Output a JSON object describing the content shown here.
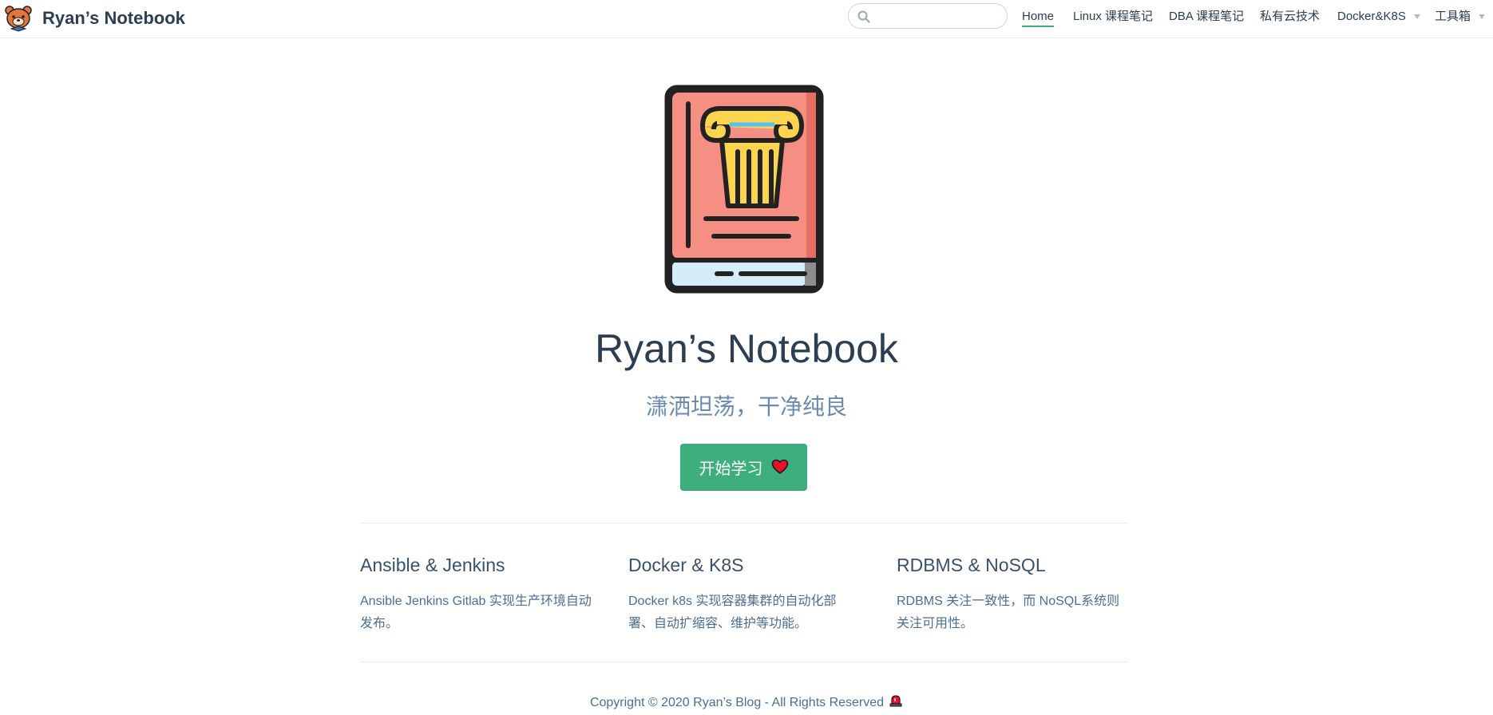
{
  "site": {
    "title": "Ryan’s Notebook"
  },
  "search": {
    "placeholder": "",
    "value": ""
  },
  "nav": {
    "items": [
      {
        "label": "Home",
        "active": true,
        "dropdown": false
      },
      {
        "label": "Linux 课程笔记",
        "active": false,
        "dropdown": false
      },
      {
        "label": "DBA 课程笔记",
        "active": false,
        "dropdown": false
      },
      {
        "label": "私有云技术",
        "active": false,
        "dropdown": false
      },
      {
        "label": "Docker&K8S",
        "active": false,
        "dropdown": true
      },
      {
        "label": "工具箱",
        "active": false,
        "dropdown": true
      }
    ]
  },
  "hero": {
    "title": "Ryan’s Notebook",
    "description": "潇洒坦荡，干净纯良",
    "action_label": "开始学习",
    "action_icon": "heart-icon"
  },
  "features": [
    {
      "title": "Ansible & Jenkins",
      "details": "Ansible Jenkins Gitlab 实现生产环境自动发布。"
    },
    {
      "title": "Docker & K8S",
      "details": "Docker k8s 实现容器集群的自动化部署、自动扩缩容、维护等功能。"
    },
    {
      "title": "RDBMS & NoSQL",
      "details": "RDBMS 关注一致性，而 NoSQL系统则关注可用性。"
    }
  ],
  "footer": {
    "text": "Copyright © 2020 Ryan’s Blog - All Rights Reserved",
    "icon": "siren-icon"
  },
  "colors": {
    "accent": "#3eaf7c",
    "text": "#2c3e50",
    "muted": "#6a8bad",
    "book_cover": "#f58f84",
    "column": "#ffd54f"
  }
}
